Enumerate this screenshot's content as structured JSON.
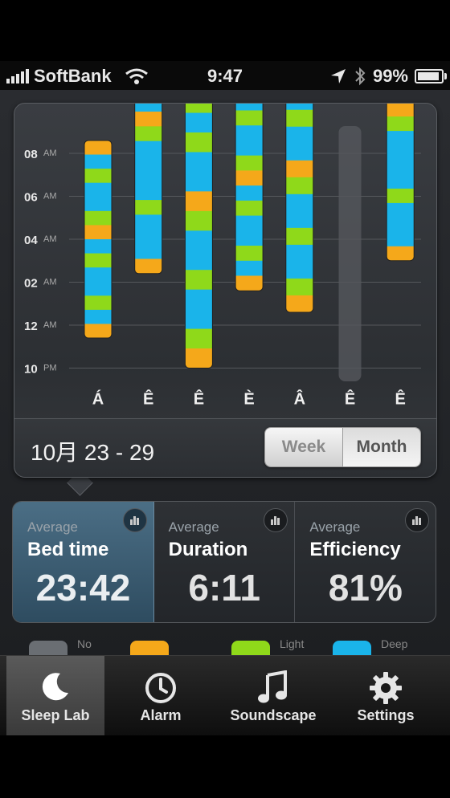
{
  "status": {
    "carrier": "SoftBank",
    "time": "9:47",
    "battery": "99%"
  },
  "chart_data": {
    "type": "sleep-range-bar",
    "y_labels": [
      {
        "hour": "08",
        "ampm": "AM"
      },
      {
        "hour": "06",
        "ampm": "AM"
      },
      {
        "hour": "04",
        "ampm": "AM"
      },
      {
        "hour": "02",
        "ampm": "AM"
      },
      {
        "hour": "12",
        "ampm": "AM"
      },
      {
        "hour": "10",
        "ampm": "PM"
      }
    ],
    "categories": [
      "Á",
      "Ê",
      "Ê",
      "È",
      "Â",
      "Ê",
      "Ê"
    ],
    "bars": [
      {
        "start_hr": 0.7,
        "end_hr": 5.3,
        "pattern": "wy"
      },
      {
        "start_hr": 2.2,
        "end_hr": 7.0,
        "pattern": "top"
      },
      {
        "start_hr": 0.0,
        "end_hr": 6.4,
        "pattern": "mix"
      },
      {
        "start_hr": 1.8,
        "end_hr": 6.7,
        "pattern": "wy"
      },
      {
        "start_hr": 1.3,
        "end_hr": 6.8,
        "pattern": "mix"
      },
      null,
      {
        "start_hr": 2.5,
        "end_hr": 7.2,
        "pattern": "top"
      }
    ],
    "highlight_index": 5,
    "colors": {
      "deep": "#1ab4ea",
      "light": "#8fd91a",
      "awake": "#f5a81a",
      "none": "#6a6e73"
    }
  },
  "range": {
    "label": "10月 23 - 29"
  },
  "segment": {
    "week": "Week",
    "month": "Month",
    "selected": "Month"
  },
  "stats": [
    {
      "caption": "Average",
      "name": "Bed time",
      "value": "23:42"
    },
    {
      "caption": "Average",
      "name": "Duration",
      "value": "6:11"
    },
    {
      "caption": "Average",
      "name": "Efficiency",
      "value": "81%"
    }
  ],
  "legend": [
    {
      "label": "No",
      "color": "#6a6e73"
    },
    {
      "label": "",
      "color": "#f5a81a"
    },
    {
      "label": "Light",
      "color": "#8fd91a"
    },
    {
      "label": "Deep",
      "color": "#1ab4ea"
    }
  ],
  "tabs": [
    {
      "label": "Sleep Lab",
      "icon": "moon-icon"
    },
    {
      "label": "Alarm",
      "icon": "clock-icon"
    },
    {
      "label": "Soundscape",
      "icon": "music-note-icon"
    },
    {
      "label": "Settings",
      "icon": "gear-icon"
    }
  ]
}
